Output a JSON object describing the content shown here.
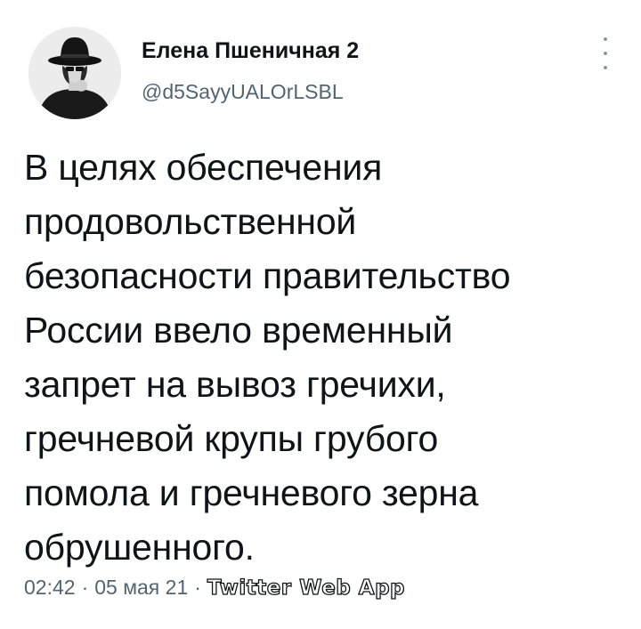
{
  "author": {
    "display_name": "Елена Пшеничная 2",
    "handle": "@d5SayyUALOrLSBL",
    "avatar_icon": "avatar-woman-in-hat"
  },
  "menu": {
    "icon": "more-vertical-icon"
  },
  "tweet": {
    "text": "В целях обеспечения\nпродовольственной\nбезопасности правительство\nРоссии ввело временный\nзапрет на вывоз гречихи,\nгречневой крупы грубого\nпомола и гречневого зерна\nобрушенного."
  },
  "meta": {
    "time": "02:42",
    "separator": "·",
    "date": "05 мая 21",
    "source": "Twitter Web App"
  },
  "colors": {
    "text_primary": "#0f1419",
    "text_secondary": "#536471",
    "background": "#ffffff"
  }
}
